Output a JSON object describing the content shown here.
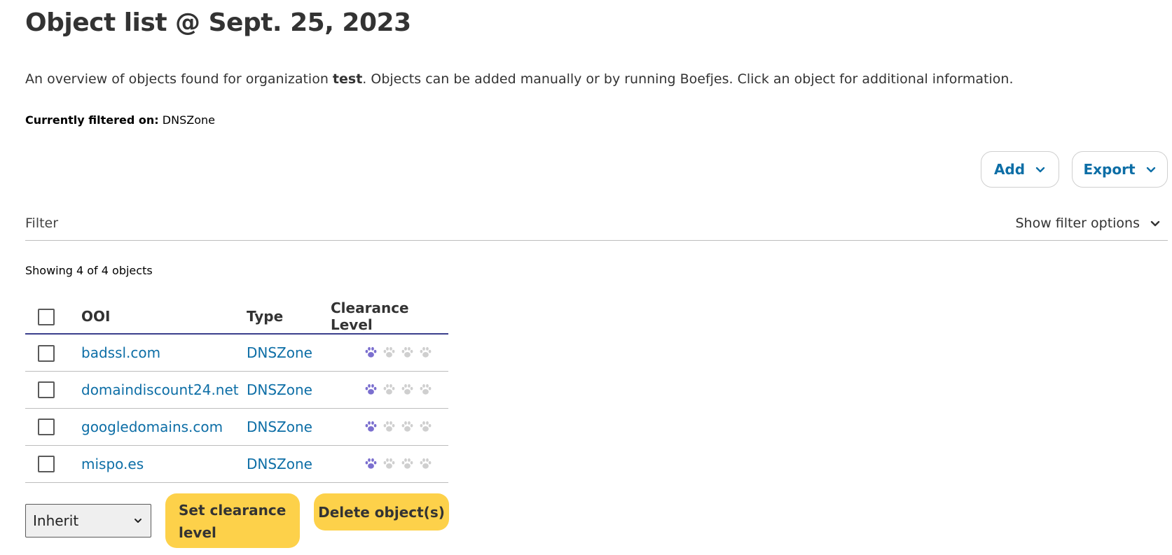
{
  "page": {
    "title": "Object list @ Sept. 25, 2023",
    "intro_before": "An overview of objects found for organization ",
    "intro_org": "test",
    "intro_after": ". Objects can be added manually or by running Boefjes. Click an object for additional information.",
    "filtered_label": "Currently filtered on:",
    "filtered_value": "DNSZone"
  },
  "actions": {
    "add_label": "Add",
    "export_label": "Export"
  },
  "filter": {
    "label": "Filter",
    "toggle_label": "Show filter options"
  },
  "table": {
    "showing": "Showing 4 of 4 objects",
    "headers": {
      "ooi": "OOI",
      "type": "Type",
      "clearance": "Clearance Level"
    },
    "rows": [
      {
        "ooi": "badssl.com",
        "type": "DNSZone",
        "clearance_level": 1,
        "clearance_max": 4
      },
      {
        "ooi": "domaindiscount24.net",
        "type": "DNSZone",
        "clearance_level": 1,
        "clearance_max": 4
      },
      {
        "ooi": "googledomains.com",
        "type": "DNSZone",
        "clearance_level": 1,
        "clearance_max": 4
      },
      {
        "ooi": "mispo.es",
        "type": "DNSZone",
        "clearance_level": 1,
        "clearance_max": 4
      }
    ]
  },
  "bulk": {
    "select_value": "Inherit",
    "set_clearance_label": "Set clearance level",
    "delete_label": "Delete object(s)"
  },
  "colors": {
    "link": "#0d6ea6",
    "paw_active": "#7b6fcf",
    "paw_inactive": "#cfcfcf",
    "button_yellow": "#fdd14a",
    "header_rule": "#3b3f8c"
  },
  "icons": {
    "dropdown": "chevron-down-icon",
    "clearance": "paw-icon"
  }
}
